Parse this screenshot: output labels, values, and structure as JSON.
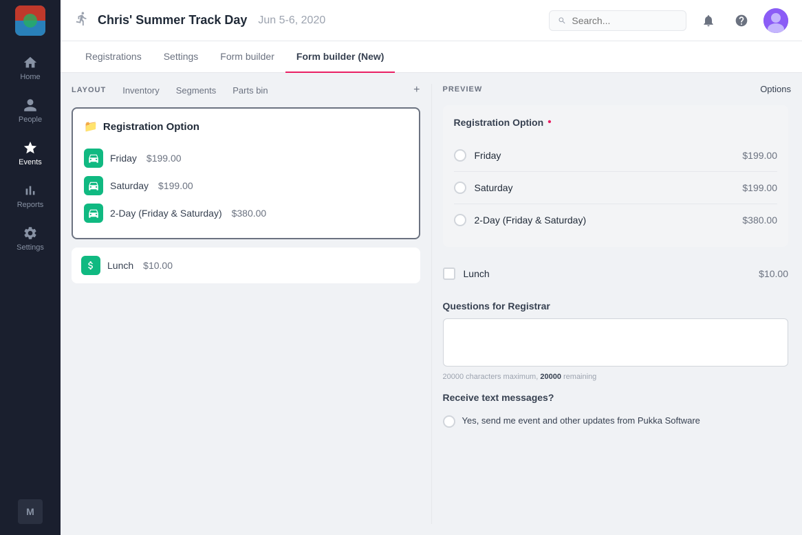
{
  "sidebar": {
    "items": [
      {
        "id": "home",
        "label": "Home",
        "icon": "home"
      },
      {
        "id": "people",
        "label": "People",
        "icon": "person"
      },
      {
        "id": "events",
        "label": "Events",
        "icon": "star",
        "active": true
      },
      {
        "id": "reports",
        "label": "Reports",
        "icon": "bar-chart"
      },
      {
        "id": "settings",
        "label": "Settings",
        "icon": "gear"
      }
    ]
  },
  "header": {
    "event_name": "Chris' Summer Track Day",
    "event_date": "Jun 5-6, 2020",
    "search_placeholder": "Search..."
  },
  "tabs": [
    {
      "id": "registrations",
      "label": "Registrations",
      "active": false
    },
    {
      "id": "settings",
      "label": "Settings",
      "active": false
    },
    {
      "id": "form-builder",
      "label": "Form builder",
      "active": false
    },
    {
      "id": "form-builder-new",
      "label": "Form builder (New)",
      "active": true
    }
  ],
  "layout": {
    "label": "LAYOUT",
    "toolbar": [
      {
        "id": "inventory",
        "label": "Inventory"
      },
      {
        "id": "segments",
        "label": "Segments"
      },
      {
        "id": "parts-bin",
        "label": "Parts bin"
      }
    ],
    "registration_group": {
      "title": "Registration Option",
      "items": [
        {
          "id": "friday",
          "label": "Friday",
          "price": "$199.00",
          "icon": "car"
        },
        {
          "id": "saturday",
          "label": "Saturday",
          "price": "$199.00",
          "icon": "car"
        },
        {
          "id": "two-day",
          "label": "2-Day (Friday & Saturday)",
          "price": "$380.00",
          "icon": "car"
        }
      ]
    },
    "lunch_item": {
      "label": "Lunch",
      "price": "$10.00",
      "icon": "dollar"
    }
  },
  "preview": {
    "label": "PREVIEW",
    "options_label": "Options",
    "registration_option": {
      "label": "Registration Option",
      "required": true,
      "items": [
        {
          "id": "friday",
          "label": "Friday",
          "price": "$199.00"
        },
        {
          "id": "saturday",
          "label": "Saturday",
          "price": "$199.00"
        },
        {
          "id": "two-day",
          "label": "2-Day (Friday & Saturday)",
          "price": "$380.00"
        }
      ]
    },
    "lunch": {
      "label": "Lunch",
      "price": "$10.00"
    },
    "questions": {
      "label": "Questions for Registrar",
      "char_max": "20000 characters maximum,",
      "char_remaining_label": "20000",
      "char_remaining_suffix": "remaining"
    },
    "text_messages": {
      "label": "Receive text messages?",
      "option_text": "Yes, send me event and other updates from Pukka Software"
    }
  }
}
